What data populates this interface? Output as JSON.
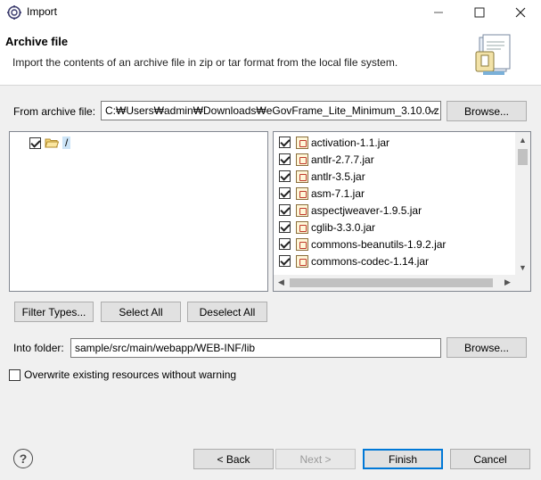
{
  "window": {
    "title": "Import",
    "minimize_icon": "minimize-icon",
    "maximize_icon": "maximize-icon",
    "close_icon": "close-icon"
  },
  "banner": {
    "title": "Archive file",
    "description": "Import the contents of an archive file in zip or tar format from the local file system."
  },
  "from_archive": {
    "label": "From archive file:",
    "value": "C:₩Users₩admin₩Downloads₩eGovFrame_Lite_Minimum_3.10.0.z",
    "browse_label": "Browse..."
  },
  "tree": {
    "root_label": "/",
    "root_checked": true
  },
  "files": [
    {
      "name": "activation-1.1.jar",
      "checked": true
    },
    {
      "name": "antlr-2.7.7.jar",
      "checked": true
    },
    {
      "name": "antlr-3.5.jar",
      "checked": true
    },
    {
      "name": "asm-7.1.jar",
      "checked": true
    },
    {
      "name": "aspectjweaver-1.9.5.jar",
      "checked": true
    },
    {
      "name": "cglib-3.3.0.jar",
      "checked": true
    },
    {
      "name": "commons-beanutils-1.9.2.jar",
      "checked": true
    },
    {
      "name": "commons-codec-1.14.jar",
      "checked": true
    }
  ],
  "selection_buttons": {
    "filter_types": "Filter Types...",
    "select_all": "Select All",
    "deselect_all": "Deselect All"
  },
  "into_folder": {
    "label": "Into folder:",
    "value": "sample/src/main/webapp/WEB-INF/lib",
    "browse_label": "Browse..."
  },
  "overwrite": {
    "label": "Overwrite existing resources without warning",
    "checked": false
  },
  "footer": {
    "back": "< Back",
    "next": "Next >",
    "finish": "Finish",
    "cancel": "Cancel"
  }
}
